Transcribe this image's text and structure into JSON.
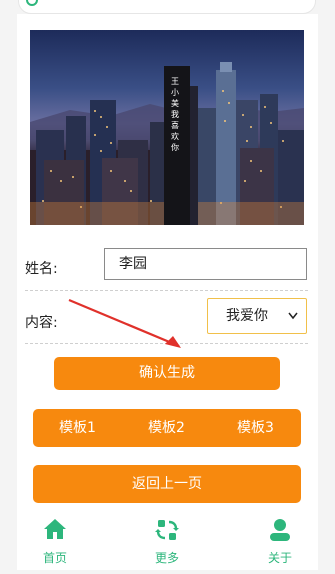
{
  "form": {
    "name_label": "姓名:",
    "name_value": "李园",
    "content_label": "内容:",
    "content_selected": "我爱你"
  },
  "hero": {
    "building_text": "王小美我喜欢你"
  },
  "buttons": {
    "confirm": "确认生成",
    "back": "返回上一页"
  },
  "templates": [
    "模板1",
    "模板2",
    "模板3"
  ],
  "tabbar": {
    "home": "首页",
    "more": "更多",
    "about": "关于"
  },
  "colors": {
    "accent_orange": "#f7890e",
    "accent_green": "#2db67c",
    "arrow_red": "#e0312b",
    "select_border": "#f1c04a"
  },
  "icons": {
    "home": "home-icon",
    "more": "refresh-swap-icon",
    "about": "user-icon",
    "chevron": "chevron-down-icon"
  }
}
